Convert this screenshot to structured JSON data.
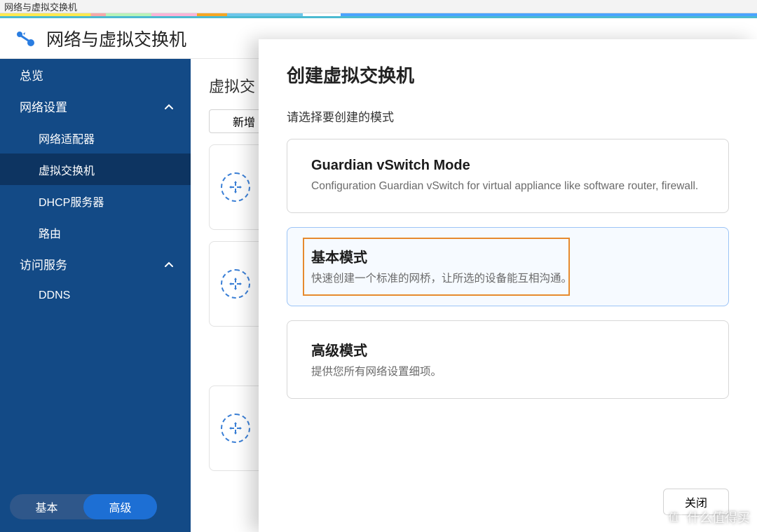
{
  "window": {
    "chrome_title": "网络与虚拟交换机"
  },
  "header": {
    "app_title": "网络与虚拟交换机"
  },
  "sidebar": {
    "items": [
      {
        "label": "总览"
      },
      {
        "label": "网络设置"
      },
      {
        "label": "网络适配器"
      },
      {
        "label": "虚拟交换机"
      },
      {
        "label": "DHCP服务器"
      },
      {
        "label": "路由"
      },
      {
        "label": "访问服务"
      },
      {
        "label": "DDNS"
      }
    ],
    "toggle": {
      "basic": "基本",
      "advanced": "高级"
    }
  },
  "main": {
    "title": "虚拟交",
    "add_button": "新增"
  },
  "modal": {
    "title": "创建虚拟交换机",
    "prompt": "请选择要创建的模式",
    "options": [
      {
        "title": "Guardian vSwitch Mode",
        "desc": "Configuration Guardian vSwitch for virtual appliance like software router, firewall."
      },
      {
        "title": "基本模式",
        "desc": "快速创建一个标准的网桥，让所选的设备能互相沟通。"
      },
      {
        "title": "高级模式",
        "desc": "提供您所有网络设置细项。"
      }
    ],
    "close": "关闭"
  },
  "watermark": {
    "text": "什么值得买",
    "glyph": "值"
  }
}
